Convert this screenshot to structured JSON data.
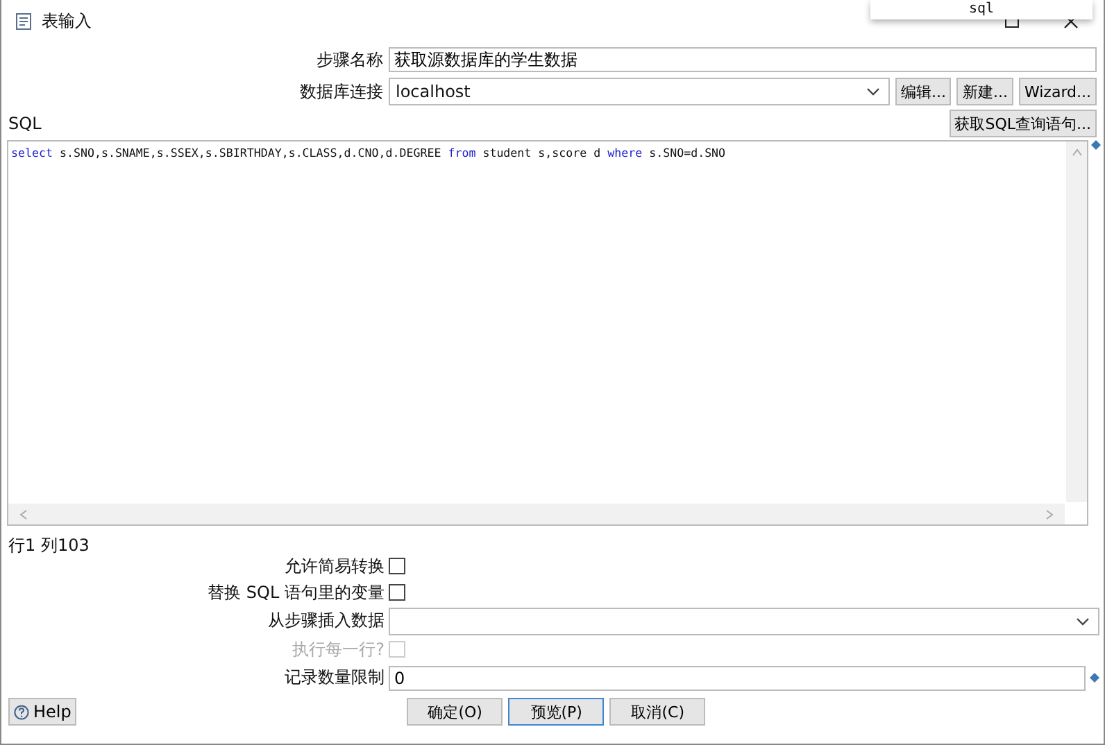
{
  "window": {
    "title": "表输入"
  },
  "popup": {
    "text": "sql"
  },
  "step_name": {
    "label": "步骤名称",
    "value": "获取源数据库的学生数据"
  },
  "connection": {
    "label": "数据库连接",
    "value": "localhost",
    "buttons": [
      "编辑...",
      "新建...",
      "Wizard..."
    ]
  },
  "sql_label": "SQL",
  "get_sql_button": "获取SQL查询语句...",
  "sql_tokens": [
    {
      "text": "select",
      "keyword": true
    },
    {
      "text": " s.SNO,s.SNAME,s.SSEX,s.SBIRTHDAY,s.CLASS,d.CNO,d.DEGREE ",
      "keyword": false
    },
    {
      "text": "from",
      "keyword": true
    },
    {
      "text": " student s,score d ",
      "keyword": false
    },
    {
      "text": "where",
      "keyword": true
    },
    {
      "text": " s.SNO=d.SNO",
      "keyword": false
    }
  ],
  "cursor_position": "行1 列103",
  "options": [
    {
      "kind": "checkbox",
      "label": "允许简易转换",
      "checked": false,
      "disabled": false
    },
    {
      "kind": "checkbox",
      "label": "替换 SQL 语句里的变量",
      "checked": false,
      "disabled": false
    },
    {
      "kind": "dropdown",
      "label": "从步骤插入数据"
    },
    {
      "kind": "checkbox",
      "label": "执行每一行?",
      "checked": false,
      "disabled": true
    },
    {
      "kind": "text",
      "label": "记录数量限制",
      "value": "0"
    }
  ],
  "help_button": "Help",
  "buttons": [
    {
      "label": "确定(O)",
      "focused": false
    },
    {
      "label": "预览(P)",
      "focused": true
    },
    {
      "label": "取消(C)",
      "focused": false
    }
  ]
}
